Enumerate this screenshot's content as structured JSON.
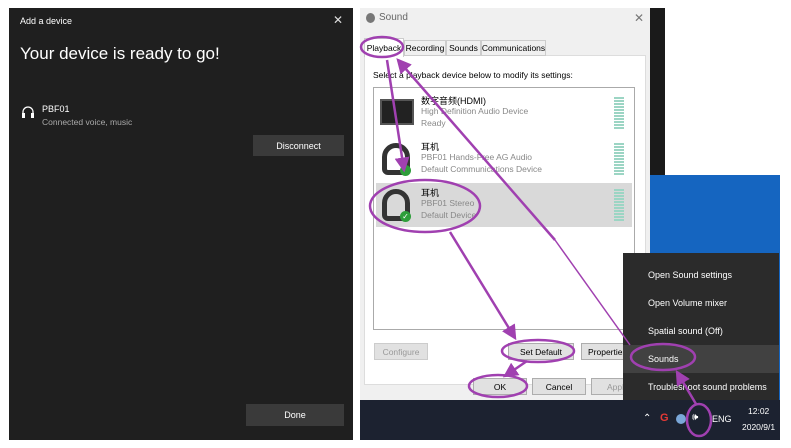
{
  "add_device": {
    "title": "Add a device",
    "heading": "Your device is ready to go!",
    "device_name": "PBF01",
    "device_status": "Connected voice, music",
    "disconnect": "Disconnect",
    "done": "Done",
    "close": "✕"
  },
  "sound": {
    "title": "Sound",
    "close": "✕",
    "tabs": [
      "Playback",
      "Recording",
      "Sounds",
      "Communications"
    ],
    "instruction": "Select a playback device below to modify its settings:",
    "devices": [
      {
        "name": "数字音频(HDMI)",
        "desc": "High Definition Audio Device",
        "status": "Ready"
      },
      {
        "name": "耳机",
        "desc": "PBF01 Hands-Free AG Audio",
        "status": "Default Communications Device"
      },
      {
        "name": "耳机",
        "desc": "PBF01 Stereo",
        "status": "Default Device"
      }
    ],
    "configure": "Configure",
    "set_default": "Set Default",
    "properties": "Properties",
    "ok": "OK",
    "cancel": "Cancel",
    "apply": "Apply"
  },
  "context_menu": {
    "items": [
      "Open Sound settings",
      "Open Volume mixer",
      "Spatial sound (Off)",
      "Sounds",
      "Troubleshoot sound problems"
    ]
  },
  "taskbar": {
    "lang": "ENG",
    "time": "12:02",
    "date": "2020/9/1"
  }
}
